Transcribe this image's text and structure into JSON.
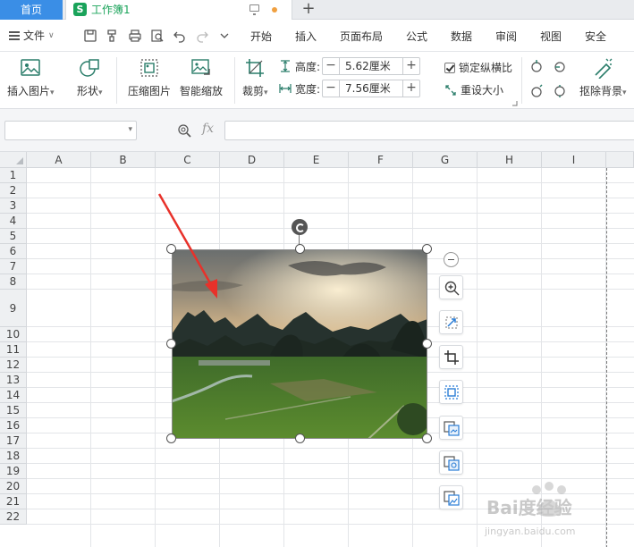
{
  "tabs": {
    "home": "首页",
    "document": "工作簿1",
    "doc_icon_letter": "S"
  },
  "menu": {
    "file": "文件",
    "items": [
      "开始",
      "插入",
      "页面布局",
      "公式",
      "数据",
      "审阅",
      "视图",
      "安全"
    ]
  },
  "ribbon": {
    "insert_picture": "插入图片",
    "shape": "形状",
    "compress_picture": "压缩图片",
    "smart_scale": "智能缩放",
    "crop": "裁剪",
    "height_label": "高度:",
    "height_value": "5.62厘米",
    "width_label": "宽度:",
    "width_value": "7.56厘米",
    "lock_ratio": "锁定纵横比",
    "reset_size": "重设大小",
    "remove_background": "抠除背景"
  },
  "formula_bar": {
    "name_box": "",
    "fx": "fx",
    "formula": ""
  },
  "grid": {
    "columns": [
      "A",
      "B",
      "C",
      "D",
      "E",
      "F",
      "G",
      "H",
      "I"
    ],
    "rows": [
      "1",
      "2",
      "3",
      "4",
      "5",
      "6",
      "7",
      "8",
      "9",
      "10",
      "11",
      "12",
      "13",
      "14",
      "15",
      "16",
      "17",
      "18",
      "19",
      "20",
      "21",
      "22"
    ]
  },
  "watermark": {
    "brand": "Bai度经验",
    "url": "jingyan.baidu.com"
  },
  "colors": {
    "accent": "#3a8ee6",
    "sheet_green": "#1aa35a",
    "arrow_red": "#e8312a"
  }
}
